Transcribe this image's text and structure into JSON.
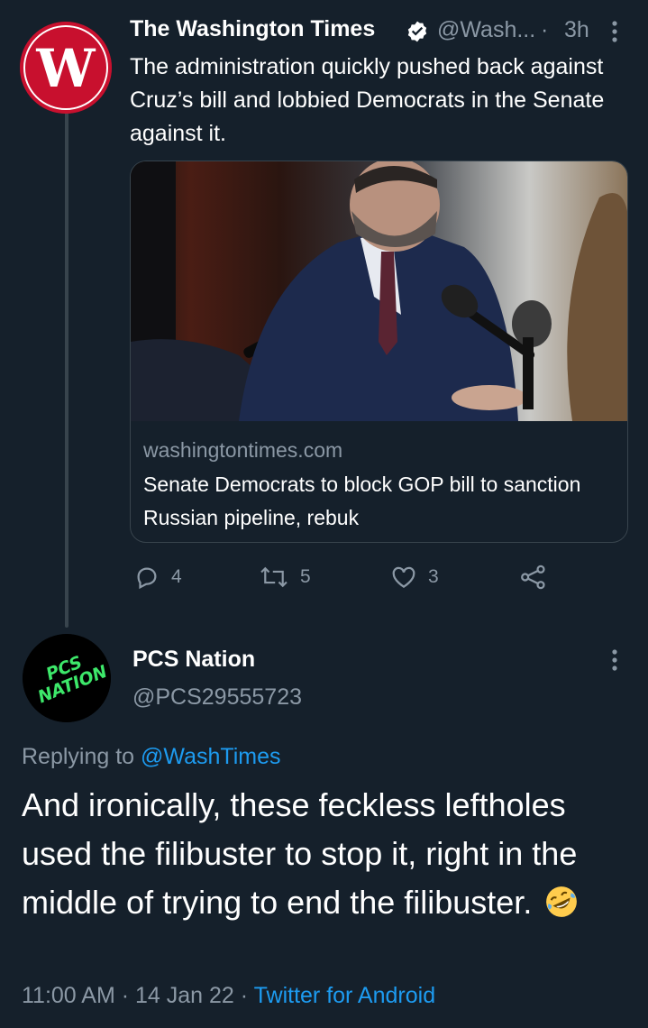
{
  "colors": {
    "background": "#15202b",
    "text": "#ffffff",
    "secondary_text": "#8b98a5",
    "link": "#1d9bf0",
    "divider": "#38444d",
    "brand_red": "#c8102e",
    "pcs_green": "#3de86a"
  },
  "tweet": {
    "author": {
      "name": "The Washington Times",
      "handle": "@Wash...",
      "avatar_letter": "W",
      "verified_icon": "verified-badge-icon"
    },
    "separator": "·",
    "time": "3h",
    "more_icon": "more-vertical-icon",
    "text": "The administration quickly pushed back against Cruz’s bill and lobbied Democrats in the Senate against it.",
    "card": {
      "image_icon": "photo",
      "domain": "washingtontimes.com",
      "title": "Senate Democrats to block GOP bill to sanction Russian pipeline, rebuk"
    },
    "actions": {
      "reply": {
        "icon": "reply-icon",
        "count": "4"
      },
      "retweet": {
        "icon": "retweet-icon",
        "count": "5"
      },
      "like": {
        "icon": "heart-icon",
        "count": "3"
      },
      "share": {
        "icon": "share-icon"
      }
    }
  },
  "reply": {
    "author": {
      "name": "PCS Nation",
      "handle": "@PCS29555723",
      "avatar_text_top": "PCS",
      "avatar_text_bottom": "NATION"
    },
    "more_icon": "more-vertical-icon",
    "replying_to_label": "Replying to",
    "replying_to_handle": "@WashTimes",
    "text": "And ironically, these feckless leftholes used the filibuster to stop it, right in the middle of trying to end the filibuster.",
    "emoji": "rolling-on-floor-laughing-emoji",
    "meta": {
      "time": "11:00 AM",
      "separator": "·",
      "date": "14 Jan 22",
      "source": "Twitter for Android"
    }
  }
}
